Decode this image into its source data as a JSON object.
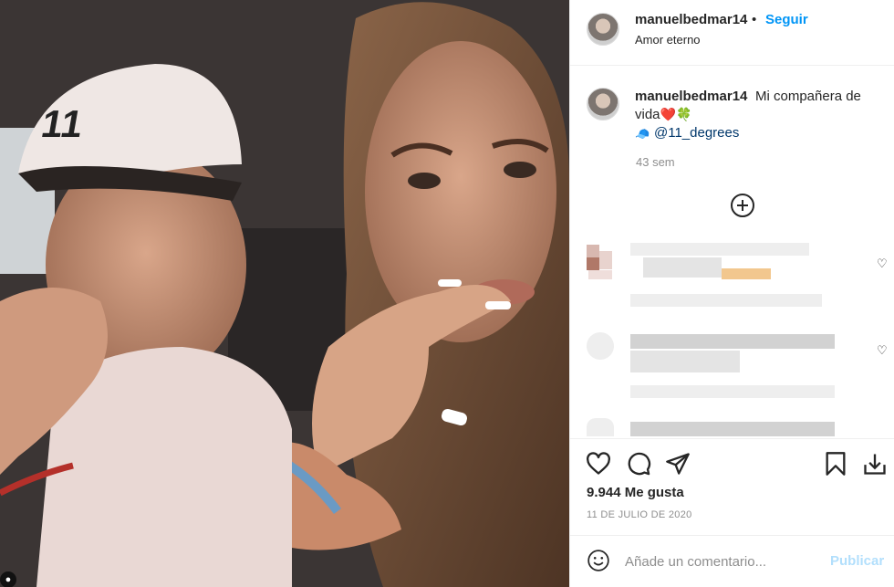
{
  "header": {
    "username": "manuelbedmar14",
    "separator": "•",
    "follow_label": "Seguir",
    "location": "Amor eterno"
  },
  "caption": {
    "username": "manuelbedmar14",
    "text_line1": "Mi compañera de",
    "text_line2": "vida",
    "heart": "❤️",
    "clover": "🍀",
    "mention_icon": "🧢",
    "mention": "@11_degrees",
    "time": "43 sem"
  },
  "icons": {
    "load_more": "plus-circle-icon",
    "like": "heart-icon",
    "comment": "comment-icon",
    "share": "paper-plane-icon",
    "save": "bookmark-icon",
    "download": "download-icon",
    "emoji": "emoji-icon"
  },
  "comment_heart": "♡",
  "likes": "9.944 Me gusta",
  "date": "11 DE JULIO DE 2020",
  "comment_box": {
    "placeholder": "Añade un comentario...",
    "publish_label": "Publicar"
  },
  "corner_glyph": "●",
  "colors": {
    "accent": "#0095f6",
    "publish_disabled": "#b2dffc",
    "text": "#262626",
    "muted": "#8e8e8e"
  }
}
